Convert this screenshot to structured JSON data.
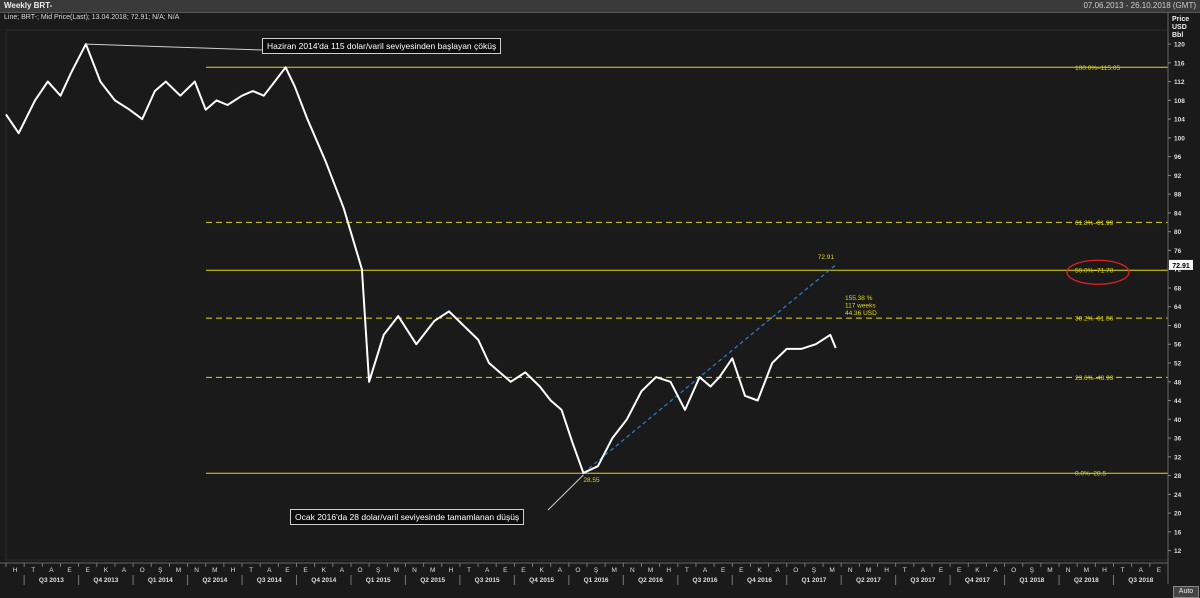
{
  "header": {
    "title": "Weekly BRT-",
    "range": "07.06.2013 - 26.10.2018 (GMT)"
  },
  "legend": "Line; BRT-; Mid Price(Last); 13.04.2018; 72.91; N/A; N/A",
  "axis_header": {
    "l1": "Price",
    "l2": "USD",
    "l3": "Bbl"
  },
  "current_price_label": "72.91",
  "auto_label": "Auto",
  "colors": {
    "background": "#1a1a1a",
    "price_line": "#ffffff",
    "fib": "#e0d810",
    "trend": "#2e7dd7",
    "highlight": "#e02020"
  },
  "chart_data": {
    "type": "line",
    "title": "Weekly BRT-",
    "ylabel": "Price USD Bbl",
    "ylim": [
      10,
      123
    ],
    "yticks": [
      12,
      16,
      20,
      24,
      28,
      32,
      36,
      40,
      44,
      48,
      52,
      56,
      60,
      64,
      68,
      72,
      76,
      80,
      84,
      88,
      92,
      96,
      100,
      104,
      108,
      112,
      116,
      120
    ],
    "x_months": [
      "H",
      "T",
      "A",
      "E",
      "E",
      "K",
      "A",
      "O",
      "Ş",
      "M",
      "N",
      "M",
      "H",
      "T",
      "A",
      "E",
      "E",
      "K",
      "A",
      "O",
      "Ş",
      "M",
      "N",
      "M",
      "H",
      "T",
      "A",
      "E",
      "E",
      "K",
      "A",
      "O",
      "Ş",
      "M",
      "N",
      "M",
      "H",
      "T",
      "A",
      "E",
      "E",
      "K",
      "A",
      "O",
      "Ş",
      "M",
      "N",
      "M",
      "H",
      "T",
      "A",
      "E",
      "E",
      "K",
      "A",
      "O",
      "Ş",
      "M",
      "N",
      "M",
      "H",
      "T",
      "A",
      "E"
    ],
    "x_quarters": [
      "Q3 2013",
      "Q4 2013",
      "Q1 2014",
      "Q2 2014",
      "Q3 2014",
      "Q4 2014",
      "Q1 2015",
      "Q2 2015",
      "Q3 2015",
      "Q4 2015",
      "Q1 2016",
      "Q2 2016",
      "Q3 2016",
      "Q4 2016",
      "Q1 2017",
      "Q2 2017",
      "Q3 2017",
      "Q4 2017",
      "Q1 2018",
      "Q2 2018",
      "Q3 2018"
    ],
    "series": [
      {
        "x": [
          0,
          0.7,
          1.6,
          2.3,
          3.0,
          3.6,
          4.4,
          5.2,
          6.0,
          6.8,
          7.5,
          8.2,
          8.8,
          9.6,
          10.4,
          11.0,
          11.6,
          12.2,
          13.0,
          13.6,
          14.2,
          14.8,
          15.4,
          15.9,
          16.6,
          17.6,
          18.6,
          19.6,
          20.0,
          20.8,
          21.6,
          22.6,
          23.6,
          24.4,
          25.2,
          26.0,
          26.6,
          27.2,
          27.8,
          28.6,
          29.4,
          30.0,
          30.6,
          31.2,
          31.8,
          32.6,
          33.4,
          34.2,
          35.0,
          35.8,
          36.6,
          37.4,
          38.2,
          38.8,
          39.3,
          40.0,
          40.7,
          41.4,
          42.2,
          43.0,
          43.8,
          44.6,
          45.4,
          45.7
        ],
        "values": [
          105,
          101,
          108,
          112,
          109,
          114,
          120,
          112,
          108,
          106,
          104,
          110,
          112,
          109,
          112,
          106,
          108,
          107,
          109,
          110,
          109,
          112,
          115.05,
          111,
          104,
          95,
          85,
          72,
          48,
          58,
          62,
          56,
          61,
          63,
          60,
          57,
          52,
          50,
          48,
          50,
          47,
          44,
          42,
          35,
          28.55,
          30,
          36,
          40,
          46,
          49,
          48,
          42,
          49,
          47,
          49,
          53,
          45,
          44,
          52,
          55,
          55,
          56,
          58,
          55.2
        ],
        "_note": "ignore"
      }
    ],
    "annotations": {
      "peak_callout": "Haziran 2014'da 115 dolar/varil seviyesinden başlayan çöküş",
      "trough_callout": "Ocak 2016'da 28 dolar/varil seviyesinde tamamlanan düşüş",
      "trough_label": "28.55",
      "end_label": "72.91",
      "trend_stats": [
        "155.38 %",
        "117 weeks",
        "44.36 USD"
      ]
    },
    "fib_levels": [
      {
        "label": "100.0%–115.05",
        "value": 115.05,
        "style": "solid"
      },
      {
        "label": "61.8%–81.99",
        "value": 81.99,
        "style": "dashed"
      },
      {
        "label": "50.0%–71.78",
        "value": 71.78,
        "style": "solid",
        "highlight": true
      },
      {
        "label": "38.2%–61.56",
        "value": 61.56,
        "style": "dashed"
      },
      {
        "label": "23.6%–48.93",
        "value": 48.93,
        "style": "dashed"
      },
      {
        "label": "0.0%–28.5",
        "value": 28.5,
        "style": "solid"
      }
    ]
  }
}
